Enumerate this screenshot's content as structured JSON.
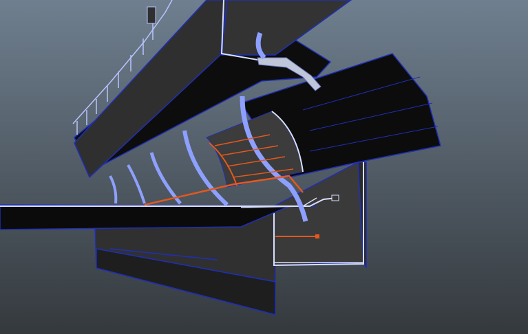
{
  "viewport": {
    "background_top": "#6f7f8f",
    "background_bottom": "#34393d",
    "shape_fill": "#3a3a3a",
    "shape_fill_dark": "#262626",
    "shape_fill_black": "#0b0b0b",
    "wire_color": "#1f2fb8",
    "highlight_color": "#d8e0ff",
    "selection_color": "#e5581c"
  },
  "scene_objects": [
    "upper-deck",
    "railing",
    "roof-canopy",
    "ribbed-arch-shell",
    "curved-ribs",
    "main-deck",
    "lower-girder",
    "vertical-support",
    "selected-stair-rails"
  ]
}
